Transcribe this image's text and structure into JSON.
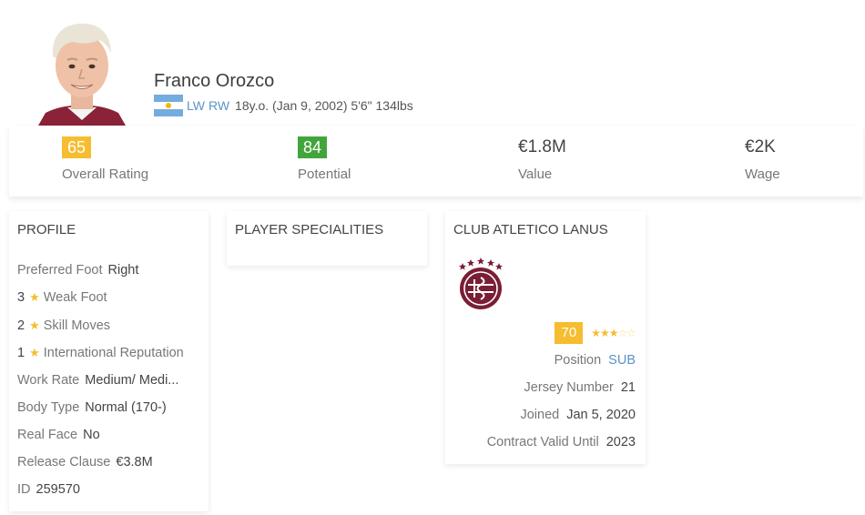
{
  "player": {
    "name": "Franco Orozco",
    "positions": [
      "LW",
      "RW"
    ],
    "details": "18y.o. (Jan 9, 2002) 5'6\" 134lbs",
    "nationality_flag": "argentina-flag"
  },
  "stats": [
    {
      "value": "65",
      "label": "Overall Rating",
      "badge_color": "#f5bd2f"
    },
    {
      "value": "84",
      "label": "Potential",
      "badge_color": "#42a53b"
    },
    {
      "value": "€1.8M",
      "label": "Value"
    },
    {
      "value": "€2K",
      "label": "Wage"
    }
  ],
  "profile": {
    "title": "PROFILE",
    "preferred_foot": {
      "label": "Preferred Foot",
      "value": "Right"
    },
    "weak_foot": {
      "value": "3",
      "label": "Weak Foot"
    },
    "skill_moves": {
      "value": "2",
      "label": "Skill Moves"
    },
    "international_reputation": {
      "value": "1",
      "label": "International Reputation"
    },
    "work_rate": {
      "label": "Work Rate",
      "value": "Medium/ Medi..."
    },
    "body_type": {
      "label": "Body Type",
      "value": "Normal (170-)"
    },
    "real_face": {
      "label": "Real Face",
      "value": "No"
    },
    "release_clause": {
      "label": "Release Clause",
      "value": "€3.8M"
    },
    "id": {
      "label": "ID",
      "value": "259570"
    }
  },
  "specialities": {
    "title": "PLAYER SPECIALITIES"
  },
  "club": {
    "title": "CLUB ATLETICO LANUS",
    "crest_icon": "club-crest-icon",
    "rating": "70",
    "stars_filled": 3,
    "stars_total": 5,
    "position": {
      "label": "Position",
      "value": "SUB"
    },
    "jersey_number": {
      "label": "Jersey Number",
      "value": "21"
    },
    "joined": {
      "label": "Joined",
      "value": "Jan 5, 2020"
    },
    "contract": {
      "label": "Contract Valid Until",
      "value": "2023"
    }
  },
  "colors": {
    "accent_blue": "#5b93c8",
    "rating_yellow": "#f5bd2f",
    "potential_green": "#42a53b",
    "club_maroon": "#7a1e34"
  }
}
